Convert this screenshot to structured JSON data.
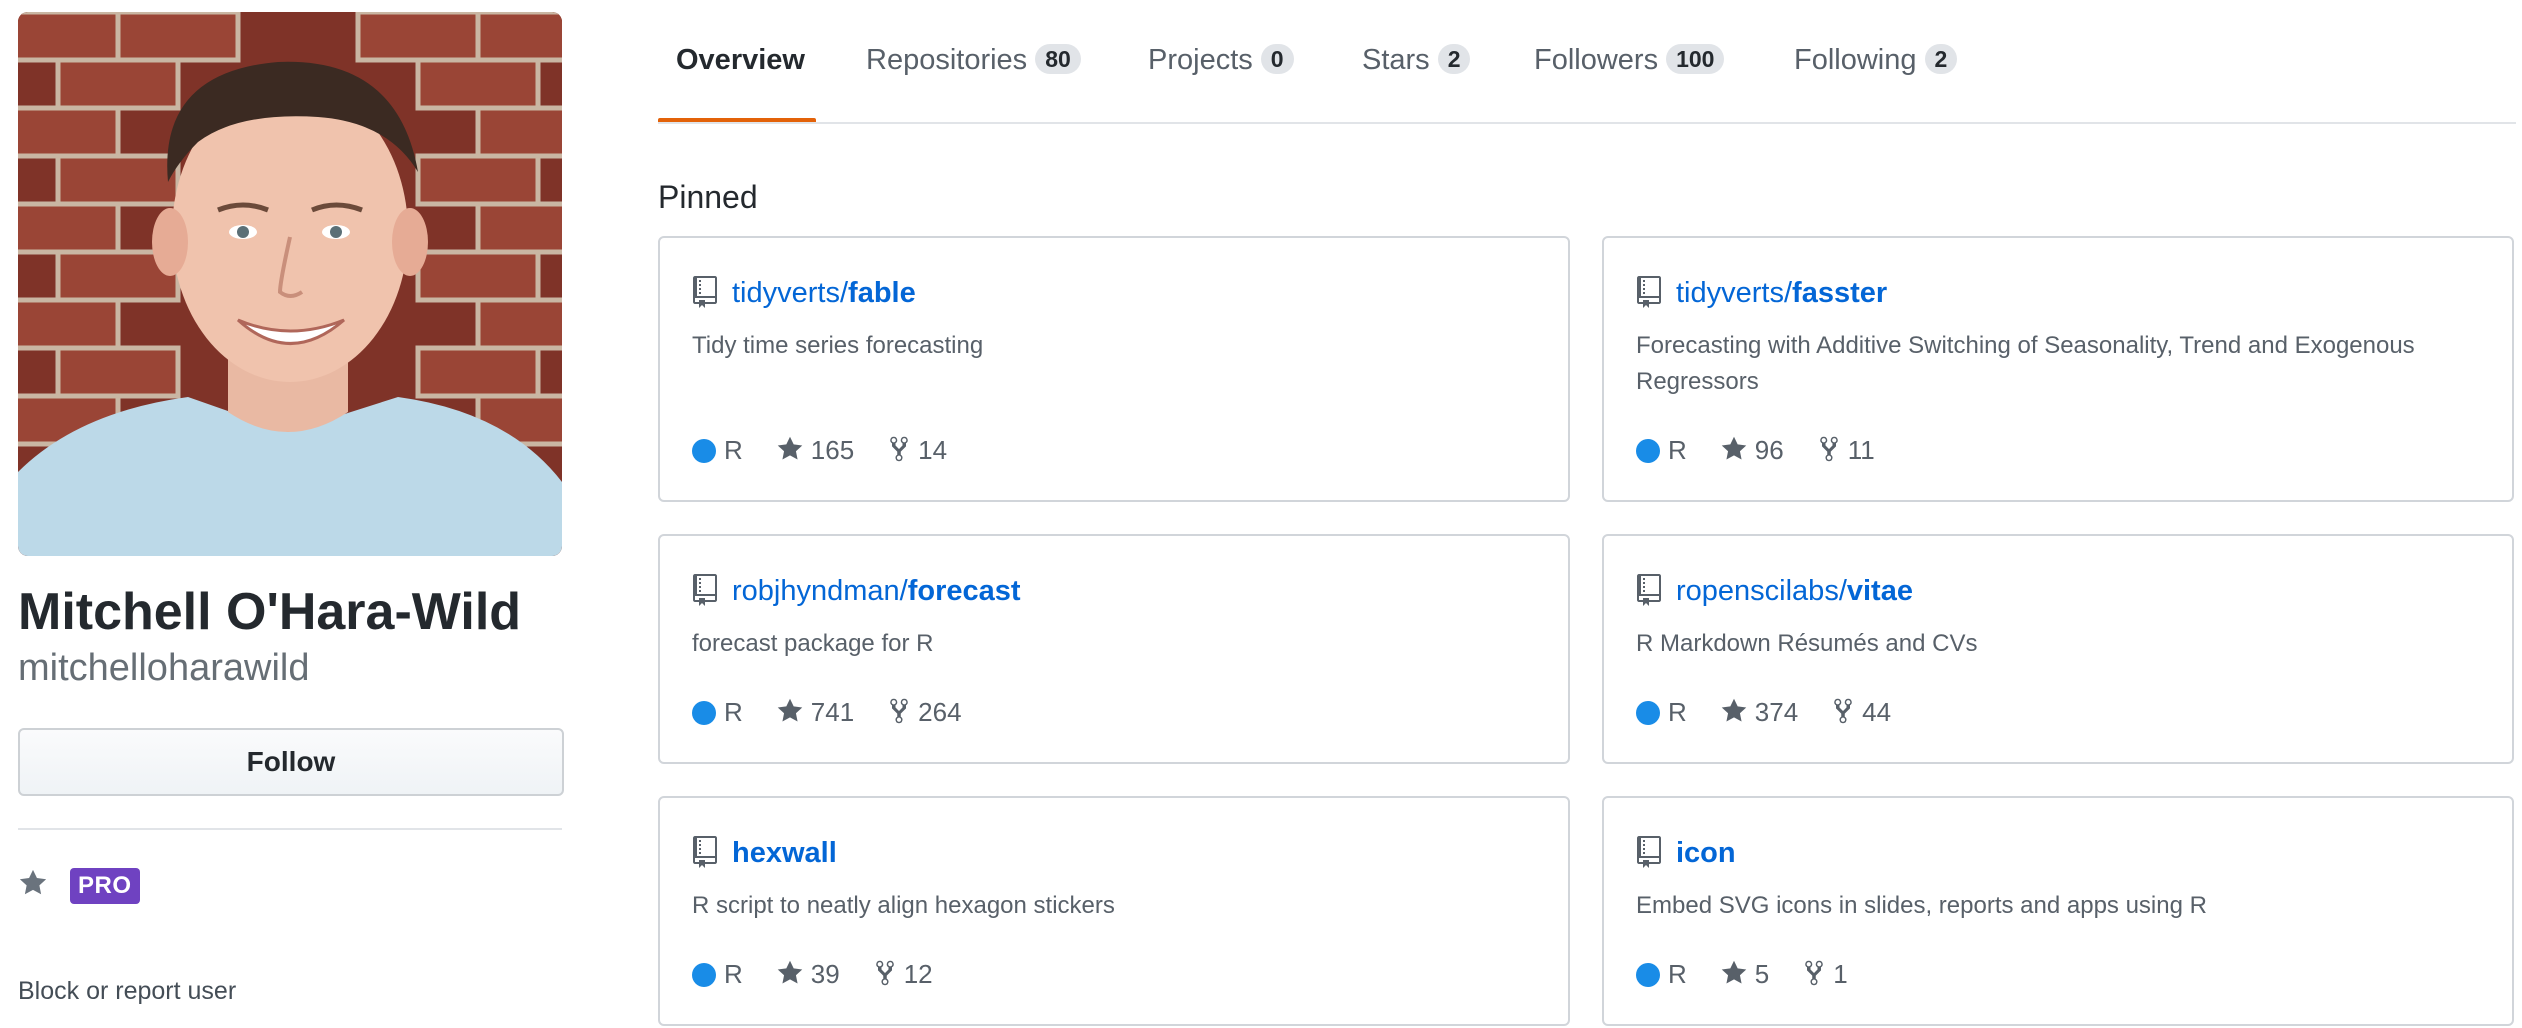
{
  "profile": {
    "full_name": "Mitchell O'Hara-Wild",
    "username": "mitchelloharawild",
    "follow_label": "Follow",
    "pro_label": "PRO",
    "block_label": "Block or report user"
  },
  "tabs": [
    {
      "label": "Overview",
      "count": ""
    },
    {
      "label": "Repositories",
      "count": "80"
    },
    {
      "label": "Projects",
      "count": "0"
    },
    {
      "label": "Stars",
      "count": "2"
    },
    {
      "label": "Followers",
      "count": "100"
    },
    {
      "label": "Following",
      "count": "2"
    }
  ],
  "pinned": {
    "title": "Pinned",
    "repos": [
      {
        "owner": "tidyverts/",
        "name": "fable",
        "description": "Tidy time series forecasting",
        "language": "R",
        "stars": "165",
        "forks": "14"
      },
      {
        "owner": "tidyverts/",
        "name": "fasster",
        "description": "Forecasting with Additive Switching of Seasonality, Trend and Exogenous Regressors",
        "language": "R",
        "stars": "96",
        "forks": "11"
      },
      {
        "owner": "robjhyndman/",
        "name": "forecast",
        "description": "forecast package for R",
        "language": "R",
        "stars": "741",
        "forks": "264"
      },
      {
        "owner": "ropenscilabs/",
        "name": "vitae",
        "description": "R Markdown Résumés and CVs",
        "language": "R",
        "stars": "374",
        "forks": "44"
      },
      {
        "owner": "",
        "name": "hexwall",
        "description": "R script to neatly align hexagon stickers",
        "language": "R",
        "stars": "39",
        "forks": "12"
      },
      {
        "owner": "",
        "name": "icon",
        "description": "Embed SVG icons in slides, reports and apps using R",
        "language": "R",
        "stars": "5",
        "forks": "1"
      }
    ]
  },
  "colors": {
    "link": "#0366d6",
    "tab_accent": "#e36209",
    "pro_badge": "#6f42c1",
    "language_r": "#198ce7"
  },
  "icons": {
    "repo": "repo-icon",
    "star": "star-icon",
    "fork": "fork-icon",
    "pro_star": "star-icon"
  }
}
